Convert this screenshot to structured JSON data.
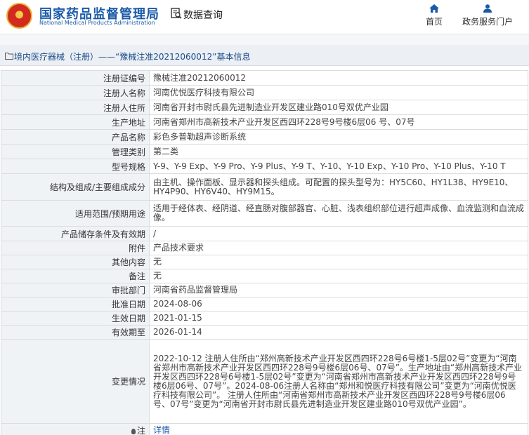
{
  "header": {
    "site_name_cn": "国家药品监督管理局",
    "site_name_en": "National Medical Products Administration",
    "section_title": "数据查询",
    "nav": {
      "home": "首页",
      "gov_portal": "政务服务门户"
    }
  },
  "breadcrumb": {
    "category": "境内医疗器械（注册）",
    "separator": "——",
    "record": "“豫械注准20212060012”",
    "suffix": "基本信息"
  },
  "fields": [
    {
      "label": "注册证编号",
      "value": "豫械注准20212060012"
    },
    {
      "label": "注册人名称",
      "value": "河南优悦医疗科技有限公司"
    },
    {
      "label": "注册人住所",
      "value": "河南省开封市尉氏县先进制造业开发区建业路010号双优产业园"
    },
    {
      "label": "生产地址",
      "value": "河南省郑州市高新技术产业开发区西四环228号9号楼6层06 号、07号"
    },
    {
      "label": "产品名称",
      "value": "彩色多普勒超声诊断系统"
    },
    {
      "label": "管理类别",
      "value": "第二类"
    },
    {
      "label": "型号规格",
      "value": "Y-9、Y-9 Exp、Y-9 Pro、Y-9 Plus、Y-9 T、Y-10、Y-10 Exp、Y-10 Pro、Y-10 Plus、Y-10 T"
    },
    {
      "label": "结构及组成/主要组成成分",
      "value": "由主机、操作面板、显示器和探头组成。可配置的探头型号为：HY5C60、HY1L38、HY9E10、HY4P90、HY6V40、HY9M15。"
    },
    {
      "label": "适用范围/预期用途",
      "value": "适用于经体表、经阴道、经直肠对腹部器官、心脏、浅表组织部位进行超声成像、血流监测和血流成像。"
    },
    {
      "label": "产品储存条件及有效期",
      "value": "/"
    },
    {
      "label": "附件",
      "value": "产品技术要求"
    },
    {
      "label": "其他内容",
      "value": "无"
    },
    {
      "label": "备注",
      "value": "无"
    },
    {
      "label": "审批部门",
      "value": "河南省药品监督管理局"
    },
    {
      "label": "批准日期",
      "value": "2024-08-06"
    },
    {
      "label": "生效日期",
      "value": "2021-01-15"
    },
    {
      "label": "有效期至",
      "value": "2026-01-14"
    },
    {
      "label": "变更情况",
      "value": "2022-10-12 注册人住所由“郑州高新技术产业开发区西四环228号6号楼1-5层02号”变更为“河南省郑州市高新技术产业开发区西四环228号9号楼6层06号、07号”。生产地址由“郑州高新技术产业开发区西四环228号6号楼1-5层02号”变更为“河南省郑州市高新技术产业开发区西四环228号9号楼6层06号、07号”。2024-08-06注册人名称由“郑州和悦医疗科技有限公司”变更为“河南优悦医疗科技有限公司”。 注册人住所由“河南省郑州市高新技术产业开发区西四环228号9号楼6层06 号、07号”变更为“河南省开封市尉氏县先进制造业开发区建业路010号双优产业园”。"
    }
  ],
  "note": {
    "label": "注",
    "link": "详情"
  },
  "colors": {
    "brand_blue": "#1a5aa8",
    "label_bg": "#f0f3f6",
    "breadcrumb_bg": "#eceff3",
    "emblem_red": "#d22a1e"
  },
  "icons": {
    "logo": "national-emblem",
    "section": "search-document-icon",
    "home": "home-icon",
    "gov": "user-icon",
    "breadcrumb": "folder-icon",
    "note": "lightbulb-icon"
  }
}
